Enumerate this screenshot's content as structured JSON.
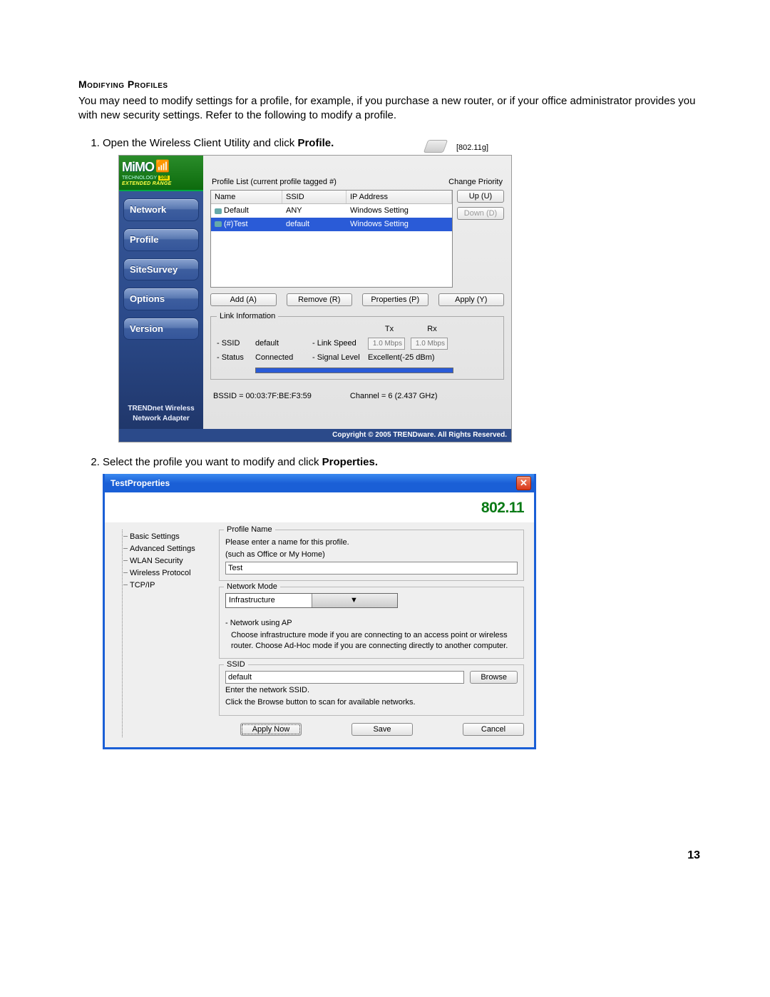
{
  "doc": {
    "section_title": "Modifying Profiles",
    "intro": "You may need to modify settings for a profile, for example, if you purchase a new router, or if your office administrator provides you with new security settings. Refer to the following to modify a profile.",
    "step1_prefix": "Open the Wireless Client Utility and click ",
    "step1_bold": "Profile.",
    "step2_prefix": "Select the profile you want to modify and click ",
    "step2_bold": "Properties.",
    "page_number": "13"
  },
  "win1": {
    "logo_main": "MiMO",
    "logo_tech": "TECHNOLOGY",
    "logo_speed": "108",
    "logo_ext": "EXTENDED RANGE",
    "nav": [
      "Network",
      "Profile",
      "SiteSurvey",
      "Options",
      "Version"
    ],
    "sidebar_footer_l1": "TRENDnet Wireless",
    "sidebar_footer_l2": "Network Adapter",
    "profile_list_label": "Profile List (current profile tagged #)",
    "change_priority_label": "Change Priority",
    "cols": {
      "name": "Name",
      "ssid": "SSID",
      "ip": "IP Address"
    },
    "rows": [
      {
        "name": "Default",
        "ssid": "ANY",
        "ip": "Windows Setting",
        "selected": false
      },
      {
        "name": "(#)Test",
        "ssid": "default",
        "ip": "Windows Setting",
        "selected": true
      }
    ],
    "btns": {
      "up": "Up (U)",
      "down": "Down (D)",
      "add": "Add (A)",
      "remove": "Remove (R)",
      "properties": "Properties (P)",
      "apply": "Apply (Y)"
    },
    "standard_tag": "[802.11g]",
    "linkinfo_legend": "Link Information",
    "txrx": {
      "tx": "Tx",
      "rx": "Rx"
    },
    "ssid_label": "- SSID",
    "ssid_val": "default",
    "status_label": "- Status",
    "status_val": "Connected",
    "linkspeed_label": "- Link Speed",
    "tx_val": "1.0 Mbps",
    "rx_val": "1.0 Mbps",
    "siglevel_label": "- Signal Level",
    "siglevel_val": "Excellent(-25 dBm)",
    "bssid": "BSSID = 00:03:7F:BE:F3:59",
    "channel": "Channel = 6 (2.437 GHz)",
    "copyright": "Copyright © 2005 TRENDware. All Rights Reserved."
  },
  "win2": {
    "title": "TestProperties",
    "standard": "802.11",
    "tree": [
      "Basic Settings",
      "Advanced Settings",
      "WLAN Security",
      "Wireless Protocol",
      "TCP/IP"
    ],
    "profile_name": {
      "legend": "Profile Name",
      "hint1": "Please enter a name for this profile.",
      "hint2": "(such as Office or My Home)",
      "value": "Test"
    },
    "network_mode": {
      "legend": "Network Mode",
      "value": "Infrastructure",
      "sub_label": "- Network using AP",
      "desc": "Choose infrastructure mode if you are connecting to an access point or wireless router. Choose Ad-Hoc mode if you are connecting directly to another computer."
    },
    "ssid": {
      "legend": "SSID",
      "value": "default",
      "browse": "Browse",
      "hint1": "Enter the network SSID.",
      "hint2": "Click the Browse button to scan for available networks."
    },
    "buttons": {
      "apply_now": "Apply Now",
      "save": "Save",
      "cancel": "Cancel"
    }
  }
}
